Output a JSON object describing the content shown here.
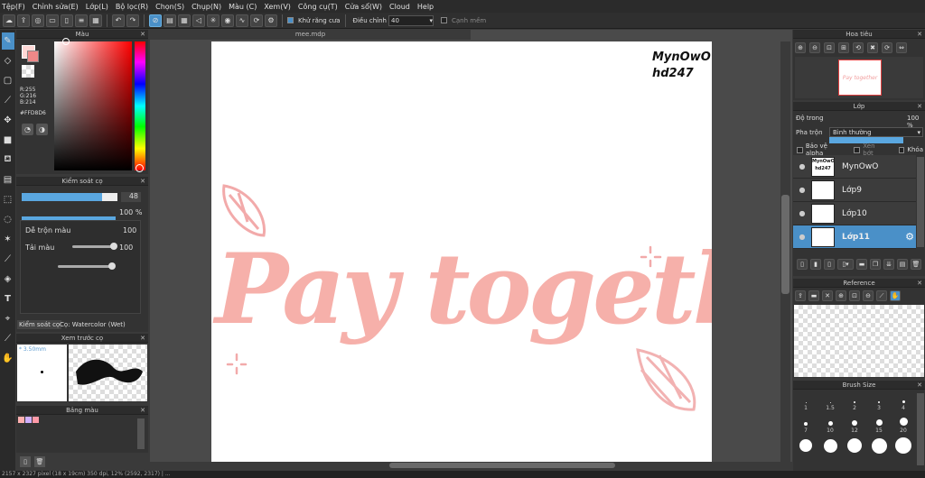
{
  "menu": [
    "Tệp(F)",
    "Chỉnh sửa(E)",
    "Lớp(L)",
    "Bộ lọc(R)",
    "Chọn(S)",
    "Chụp(N)",
    "Màu (C)",
    "Xem(V)",
    "Công cụ(T)",
    "Cửa sổ(W)",
    "Cloud",
    "Help"
  ],
  "toolbar": {
    "antialias_label": "Khử răng cưa",
    "adjust_label": "Điều chỉnh",
    "adjust_value": "40",
    "snap_label": "Cạnh mềm"
  },
  "color_panel": {
    "title": "Màu",
    "r": "R:255",
    "g": "G:216",
    "b": "B:214",
    "hex": "#FFD8D6",
    "fg_color": "#ffd8d6"
  },
  "brush_control": {
    "title": "Kiểm soát cọ",
    "size_value": "48",
    "size_fraction": 0.84,
    "opacity_value": "100 %",
    "mix_label": "Dễ trộn màu",
    "mix_value": "100",
    "load_label": "Tải màu",
    "load_value": "100",
    "tab1": "Kiểm soát cọ",
    "tab2": "Cọ: Watercolor (Wet)"
  },
  "preview": {
    "title": "Xem trước cọ",
    "size_text": "* 3.50mm"
  },
  "palette": {
    "title": "Bảng màu",
    "swatches": [
      "#ffb0b0",
      "#d0b0ff",
      "#ff9aa8"
    ]
  },
  "document": {
    "tab_name": "mee.mdp",
    "watermark_line1": "MynOwO",
    "watermark_line2": "hd247",
    "artwork_text": "Pay together"
  },
  "navigator": {
    "title": "Hoa tiêu"
  },
  "layers": {
    "title": "Lớp",
    "opacity_label": "Độ trong",
    "opacity_value": "100 %",
    "blend_label": "Pha trộn",
    "blend_value": "Bình thường",
    "protect_alpha": "Bảo vệ alpha",
    "clipping": "Xén bớt",
    "lock": "Khóa",
    "items": [
      {
        "name": "MynOwO",
        "thumb": "MynOwO hd247"
      },
      {
        "name": "Lớp9",
        "thumb": ""
      },
      {
        "name": "Lớp10",
        "thumb": ""
      },
      {
        "name": "Lớp11",
        "thumb": ""
      }
    ]
  },
  "reference": {
    "title": "Reference"
  },
  "brush_size": {
    "title": "Brush Size",
    "row1": [
      "1",
      "1.5",
      "2",
      "3",
      "4"
    ],
    "row2": [
      "7",
      "10",
      "12",
      "15",
      "20"
    ]
  },
  "status": "2157 x 2327 pixel (18 x 19cm) 350 dpi, 12% (2592, 2317) | ..."
}
